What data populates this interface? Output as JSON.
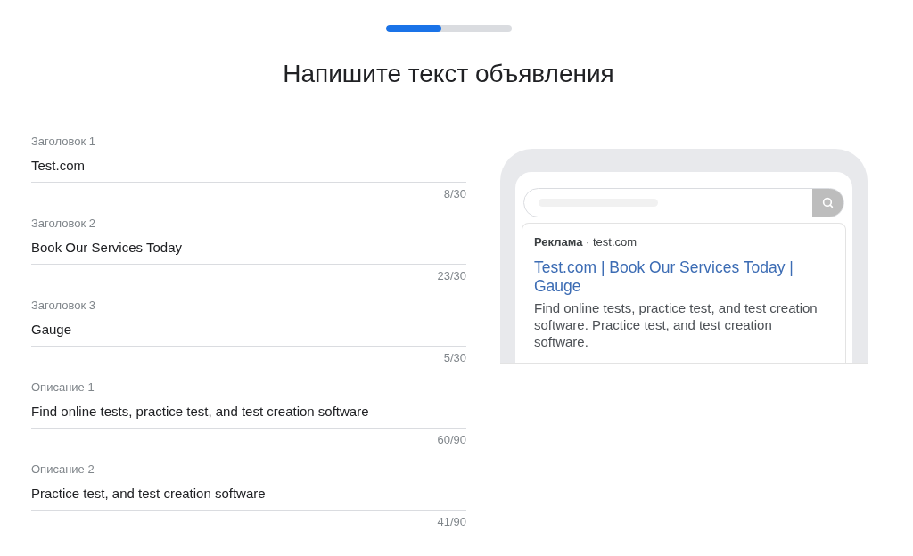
{
  "progress": {
    "level": 0.44
  },
  "title": "Напишите текст объявления",
  "fields": [
    {
      "label": "Заголовок 1",
      "value": "Test.com",
      "counter": "8/30"
    },
    {
      "label": "Заголовок 2",
      "value": "Book Our Services Today",
      "counter": "23/30"
    },
    {
      "label": "Заголовок 3",
      "value": "Gauge",
      "counter": "5/30"
    },
    {
      "label": "Описание 1",
      "value": "Find online tests, practice test, and test creation software",
      "counter": "60/90"
    },
    {
      "label": "Описание 2",
      "value": "Practice test, and test creation software",
      "counter": "41/90"
    }
  ],
  "preview": {
    "ad_line": "**Реклама** · test.com",
    "headline": "Test.com | Book Our Services Today | Gauge",
    "description": "Find online tests, practice test, and test creation software. Practice test, and test creation software."
  }
}
